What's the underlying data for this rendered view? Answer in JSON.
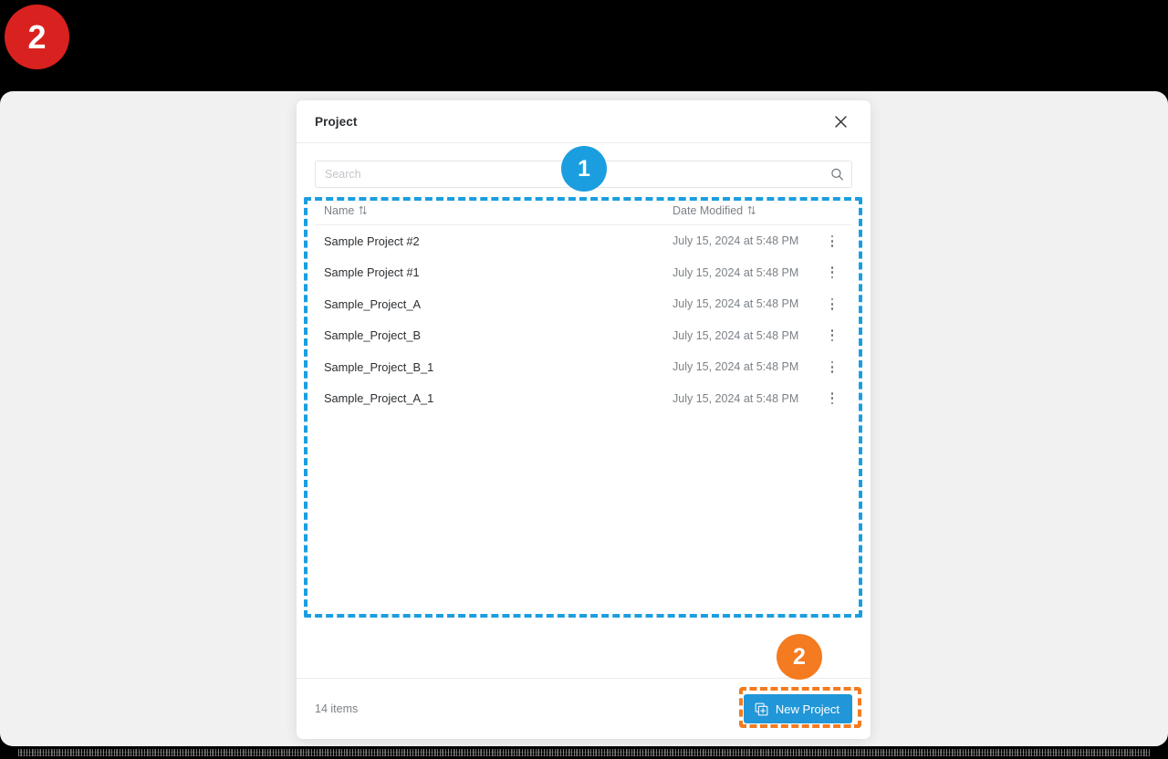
{
  "window": {
    "background_color": "#000000",
    "page_color": "#f1f1f1"
  },
  "modal": {
    "title": "Project",
    "close_icon": "close-icon"
  },
  "search": {
    "value": "",
    "placeholder": "Search",
    "icon": "search-icon"
  },
  "table": {
    "columns": [
      {
        "key": "name",
        "label": "Name",
        "sort_icon": "sort-arrows-icon"
      },
      {
        "key": "date",
        "label": "Date Modified",
        "sort_icon": "sort-arrows-icon"
      }
    ],
    "rows": [
      {
        "name": "Sample Project #2",
        "date": "July 15, 2024 at 5:48 PM",
        "menu_icon": "more-vertical-icon"
      },
      {
        "name": "Sample Project #1",
        "date": "July 15, 2024 at 5:48 PM",
        "menu_icon": "more-vertical-icon"
      },
      {
        "name": "Sample_Project_A",
        "date": "July 15, 2024 at 5:48 PM",
        "menu_icon": "more-vertical-icon"
      },
      {
        "name": "Sample_Project_B",
        "date": "July 15, 2024 at 5:48 PM",
        "menu_icon": "more-vertical-icon"
      },
      {
        "name": "Sample_Project_B_1",
        "date": "July 15, 2024 at 5:48 PM",
        "menu_icon": "more-vertical-icon"
      },
      {
        "name": "Sample_Project_A_1",
        "date": "July 15, 2024 at 5:48 PM",
        "menu_icon": "more-vertical-icon"
      }
    ]
  },
  "footer": {
    "item_count": "14 items",
    "new_project_label": "New Project",
    "new_project_icon": "new-project-icon",
    "new_project_color": "#2196d8"
  },
  "annotations": {
    "badge_corner": {
      "label": "2",
      "color": "#d9211f"
    },
    "badge_list": {
      "label": "1",
      "color": "#1b9ee0"
    },
    "badge_button": {
      "label": "2",
      "color": "#f47b20"
    },
    "highlight_list_color": "#1b9ee0",
    "highlight_button_color": "#f47b20"
  }
}
